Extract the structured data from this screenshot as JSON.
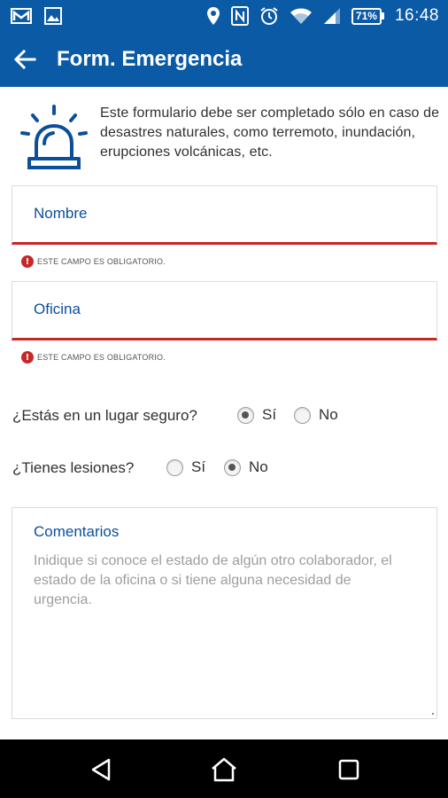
{
  "status_bar": {
    "time": "16:48",
    "battery": "71%",
    "icons": [
      "gmail-icon",
      "image-icon",
      "location-icon",
      "nfc-icon",
      "alarm-clock-icon",
      "wifi-icon",
      "signal-icon",
      "battery-icon"
    ]
  },
  "app_bar": {
    "title": "Form. Emergencia",
    "back_icon": "arrow-left-icon"
  },
  "intro": {
    "icon": "siren-icon",
    "text": "Este formulario debe ser completado sólo en caso de desastres naturales, como terremoto, inundación, erupciones volcánicas, etc."
  },
  "fields": {
    "name_label": "Nombre",
    "office_label": "Oficina",
    "error_text": "ESTE CAMPO ES OBLIGATORIO."
  },
  "questions": {
    "safe": {
      "label": "¿Estás en un lugar seguro?",
      "yes": "Sí",
      "no": "No",
      "selected": "yes"
    },
    "injuries": {
      "label": "¿Tienes lesiones?",
      "yes": "Sí",
      "no": "No",
      "selected": "no"
    }
  },
  "comments": {
    "label": "Comentarios",
    "placeholder": "Inidique si conoce el estado de algún otro colaborador, el estado de la oficina o si tiene alguna necesidad de urgencia."
  },
  "colors": {
    "primary": "#0b5aa6",
    "label_blue": "#0b4f9a",
    "error_red": "#c62828"
  },
  "nav_bar": {
    "icons": [
      "back-triangle-icon",
      "home-icon",
      "recents-icon"
    ]
  }
}
